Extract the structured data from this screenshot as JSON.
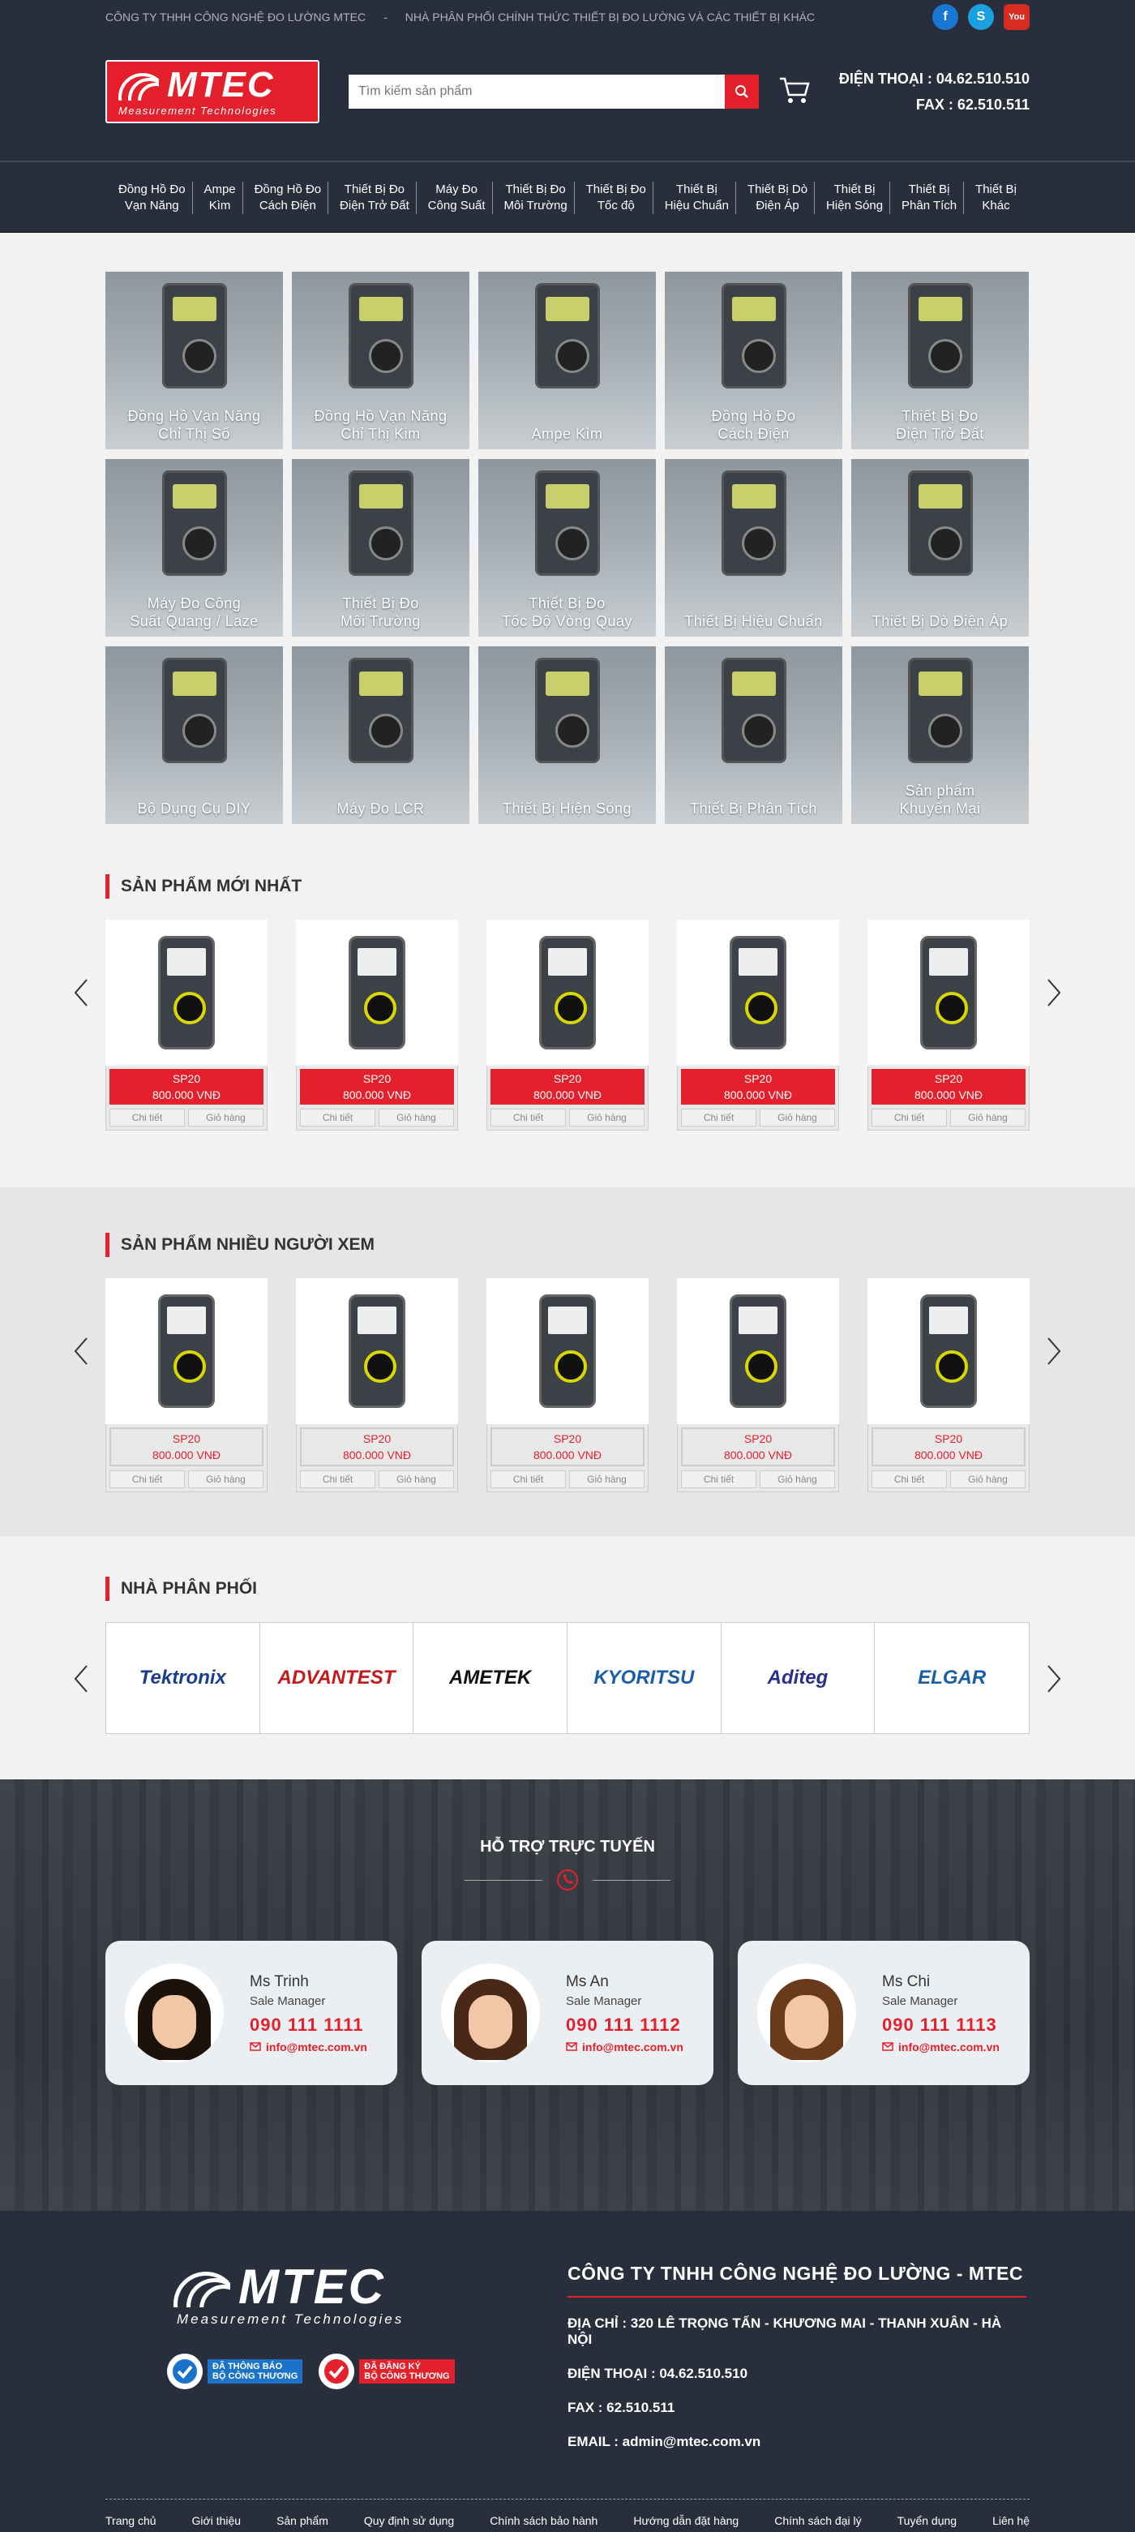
{
  "topbar": {
    "company": "CÔNG TY  THHH CÔNG NGHỆ ĐO LƯỜNG MTEC",
    "separator": "-",
    "tagline": "NHÀ PHÂN PHỐI CHÍNH THỨC THIẾT BỊ ĐO LƯỜNG VÀ CÁC THIẾT BỊ KHÁC",
    "social": [
      {
        "name": "facebook-icon",
        "glyph": "f"
      },
      {
        "name": "skype-icon",
        "glyph": "S"
      },
      {
        "name": "youtube-icon",
        "glyph": "You"
      }
    ]
  },
  "header": {
    "logo_text": "MTEC",
    "logo_sub": "Measurement Technologies",
    "search_placeholder": "Tìm kiếm sản phẩm",
    "phone": "ĐIỆN THOẠI : 04.62.510.510",
    "fax": "FAX : 62.510.511"
  },
  "nav": [
    "Đồng Hồ Đo\nVạn Năng",
    "Ampe\nKìm",
    "Đồng Hồ Đo\nCách Điện",
    "Thiết Bị Đo\nĐiện Trở Đất",
    "Máy Đo\nCông Suất",
    "Thiết Bị Đo\nMôi Trường",
    "Thiết Bị Đo\nTốc độ",
    "Thiết Bị\nHiệu Chuẩn",
    "Thiết Bị Dò\nĐiện Áp",
    "Thiết Bị\nHiện Sóng",
    "Thiết Bị\nPhân Tích",
    "Thiết Bị\nKhác"
  ],
  "categories": [
    "Đồng Hồ Vạn Năng\nChỉ Thị Số",
    "Đồng Hồ Vạn Năng\nChỉ Thị Kim",
    "Ampe Kìm",
    "Đồng Hồ Đo\nCách Điện",
    "Thiết Bị Đo\nĐiện Trở Đất",
    "Máy Đo Công\nSuất Quang / Laze",
    "Thiết Bị Đo\nMôi Trường",
    "Thiết Bị Đo\nTốc Độ Vòng Quay",
    "Thiết Bị Hiệu Chuẩn",
    "Thiết Bị Dò Điện Áp",
    "Bộ Dụng Cụ DIY",
    "Máy Đo LCR",
    "Thiết Bị Hiện Sóng",
    "Thiết Bị Phân Tích",
    "Sản phẩm\nKhuyến Mại"
  ],
  "new_products": {
    "title": "SẢN PHẨM MỚI NHẤT",
    "items": [
      {
        "name": "SP20",
        "price": "800.000 VNĐ",
        "detail": "Chi tiết",
        "cart": "Giỏ hàng"
      },
      {
        "name": "SP20",
        "price": "800.000 VNĐ",
        "detail": "Chi tiết",
        "cart": "Giỏ hàng"
      },
      {
        "name": "SP20",
        "price": "800.000 VNĐ",
        "detail": "Chi tiết",
        "cart": "Giỏ hàng"
      },
      {
        "name": "SP20",
        "price": "800.000 VNĐ",
        "detail": "Chi tiết",
        "cart": "Giỏ hàng"
      },
      {
        "name": "SP20",
        "price": "800.000 VNĐ",
        "detail": "Chi tiết",
        "cart": "Giỏ hàng"
      }
    ]
  },
  "viewed_products": {
    "title": "SẢN PHẨM NHIỀU NGƯỜI XEM",
    "items": [
      {
        "name": "SP20",
        "price": "800.000 VNĐ",
        "detail": "Chi tiết",
        "cart": "Giỏ hàng"
      },
      {
        "name": "SP20",
        "price": "800.000 VNĐ",
        "detail": "Chi tiết",
        "cart": "Giỏ hàng"
      },
      {
        "name": "SP20",
        "price": "800.000 VNĐ",
        "detail": "Chi tiết",
        "cart": "Giỏ hàng"
      },
      {
        "name": "SP20",
        "price": "800.000 VNĐ",
        "detail": "Chi tiết",
        "cart": "Giỏ hàng"
      },
      {
        "name": "SP20",
        "price": "800.000 VNĐ",
        "detail": "Chi tiết",
        "cart": "Giỏ hàng"
      }
    ]
  },
  "partners": {
    "title": "NHÀ PHÂN PHỐI",
    "logos": [
      {
        "text": "Tektronix",
        "color": "#1a3e8c"
      },
      {
        "text": "ADVANTEST",
        "color": "#c41a1a"
      },
      {
        "text": "AMETEK",
        "color": "#111111"
      },
      {
        "text": "KYORITSU",
        "color": "#1a5ea8"
      },
      {
        "text": "Aditeg",
        "color": "#2a2e8c"
      },
      {
        "text": "ELGAR",
        "color": "#1a5ea8"
      }
    ]
  },
  "support": {
    "title": "HỖ TRỢ TRỰC TUYẾN",
    "agents": [
      {
        "name": "Ms Trinh",
        "role": "Sale Manager",
        "phone": "090 111 1111",
        "email": "info@mtec.com.vn"
      },
      {
        "name": "Ms An",
        "role": "Sale Manager",
        "phone": "090 111 1112",
        "email": "info@mtec.com.vn"
      },
      {
        "name": "Ms Chi",
        "role": "Sale Manager",
        "phone": "090 111 1113",
        "email": "info@mtec.com.vn"
      }
    ]
  },
  "footer": {
    "logo_text": "MTEC",
    "logo_sub": "Measurement Technologies",
    "badge1": "ĐÃ THÔNG BÁO\nBỘ CÔNG THƯƠNG",
    "badge2": "ĐÃ ĐĂNG KÝ\nBỘ CÔNG THƯƠNG",
    "company": "CÔNG TY TNHH CÔNG NGHỆ ĐO LƯỜNG - MTEC",
    "address": "ĐỊA CHỈ : 320 LÊ TRỌNG TẤN - KHƯƠNG MAI - THANH XUÂN - HÀ NỘI",
    "phone": "ĐIỆN THOẠI : 04.62.510.510",
    "fax": "FAX : 62.510.511",
    "email": "EMAIL : admin@mtec.com.vn",
    "links": [
      "Trang chủ",
      "Giới thiệu",
      "Sản phẩm",
      "Quy định sử dụng",
      "Chính sách bảo hành",
      "Hướng dẫn đặt hàng",
      "Chính sách đại lý",
      "Tuyển dụng",
      "Liên hệ"
    ]
  },
  "colors": {
    "brand_red": "#e3202b",
    "dark": "#282e3c"
  }
}
